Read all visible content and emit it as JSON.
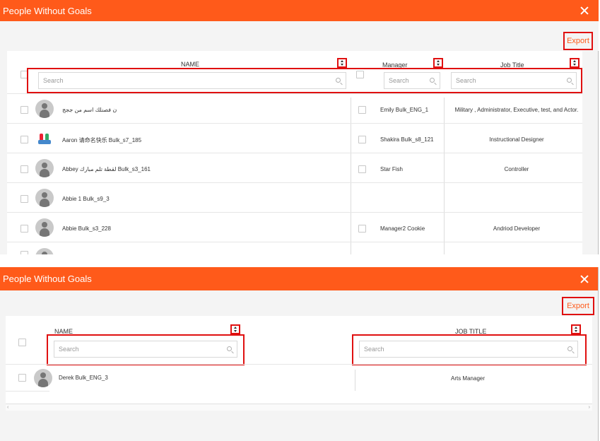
{
  "dialog1": {
    "title": "People Without Goals",
    "export_label": "Export",
    "columns": {
      "name": "NAME",
      "manager": "Manager",
      "job_title": "Job Title"
    },
    "search_placeholder": "Search",
    "rows": [
      {
        "name": "ن فصنلك اسم من ججج",
        "manager": "Emily Bulk_ENG_1",
        "job_title": "Military , Administrator, Executive, test, and Actor.",
        "avatar": "default"
      },
      {
        "name": "Aaron 请命名快乐 Bulk_s7_185",
        "manager": "Shakira Bulk_s8_121",
        "job_title": "Instructional Designer",
        "avatar": "photo"
      },
      {
        "name": "Abbey لقطة تلم مبارك Bulk_s3_161",
        "manager": "Star Fish",
        "job_title": "Controller",
        "avatar": "default"
      },
      {
        "name": "Abbie 1 Bulk_s9_3",
        "manager": "",
        "job_title": "",
        "avatar": "default"
      },
      {
        "name": "Abbie Bulk_s3_228",
        "manager": "Manager2 Cookie",
        "job_title": "Andriod Developer",
        "avatar": "default"
      }
    ]
  },
  "dialog2": {
    "title": "People Without Goals",
    "export_label": "Export",
    "columns": {
      "name": "NAME",
      "job_title": "JOB TITLE"
    },
    "search_placeholder": "Search",
    "rows": [
      {
        "name": "Derek Bulk_ENG_3",
        "job_title": "Arts Manager",
        "avatar": "default"
      }
    ],
    "scroll_left": "‹",
    "scroll_right": "›"
  },
  "colors": {
    "titlebar": "#ff5a1a",
    "highlight": "#e01010",
    "accent_text": "#ff5a1a"
  }
}
